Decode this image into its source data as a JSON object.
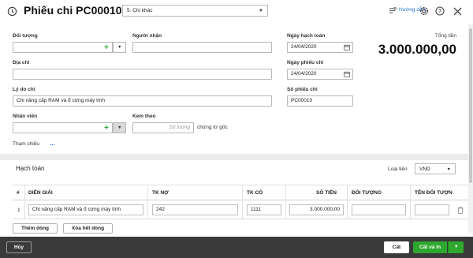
{
  "header": {
    "title": "Phiếu chi PC00010",
    "type_select": "5. Chi khác",
    "help_link": "Hướng dẫn"
  },
  "form": {
    "doi_tuong_label": "Đối tượng",
    "nguoi_nhan_label": "Người nhận",
    "dia_chi_label": "Địa chỉ",
    "ly_do_chi_label": "Lý do chi",
    "ly_do_chi_value": "Chi  nâng cấp RAM và ổ cứng máy tính",
    "nhan_vien_label": "Nhân viên",
    "kem_theo_label": "Kèm theo",
    "kem_theo_placeholder": "Số lượng",
    "chung_tu_goc": "chứng từ gốc",
    "tham_chieu_label": "Tham chiếu",
    "tham_chieu_more": "..."
  },
  "dates": {
    "ngay_hach_toan_label": "Ngày hạch toán",
    "ngay_hach_toan_value": "24/04/2020",
    "ngay_phieu_chi_label": "Ngày phiếu chi",
    "ngay_phieu_chi_value": "24/04/2020",
    "so_phieu_chi_label": "Số phiếu chi",
    "so_phieu_chi_value": "PC00010"
  },
  "total": {
    "label": "Tổng tiền",
    "value": "3.000.000,00"
  },
  "hach_toan": {
    "tab_label": "Hạch toán",
    "currency_label": "Loại tiền",
    "currency_value": "VND",
    "columns": [
      "#",
      "DIỄN GIẢI",
      "TK NỢ",
      "TK CÓ",
      "SỐ TIỀN",
      "ĐỐI TƯỢNG",
      "TÊN ĐỐI TƯỢN"
    ],
    "rows": [
      {
        "index": "1",
        "dien_giai": "Chi  nâng cấp RAM và ổ cứng máy tính",
        "tk_no": "242",
        "tk_co": "1111",
        "so_tien": "3.000.000,00",
        "doi_tuong": "",
        "ten_doi_tuong": ""
      }
    ],
    "add_row_label": "Thêm dòng",
    "clear_rows_label": "Xóa hết dòng"
  },
  "footer": {
    "cancel_label": "Hủy",
    "save_label": "Cất",
    "save_print_label": "Cất và In"
  },
  "colors": {
    "accent_green": "#2ea82e",
    "footer_bg": "#3a3a3a",
    "link_blue": "#1a6fd1"
  }
}
